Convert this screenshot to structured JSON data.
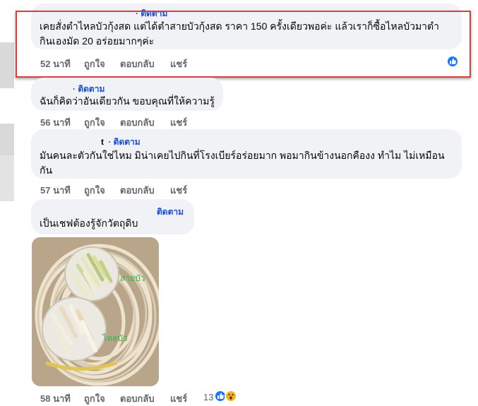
{
  "comments": [
    {
      "follow_label": "· ติดตาม",
      "text_line1": "เคยสั่งตำไหลบัวกุ้งสด แต่ได้ตำสายบัวกุ้งสด ราคา 150 ครั้งเดียวพอค่ะ แล้วเราก็ซื้อไหลบัวมาตำ",
      "text_line2": "กินเองมัด 20 อร่อยมากๆค่ะ",
      "time": "52 นาที",
      "like": "ถูกใจ",
      "reply": "ตอบกลับ",
      "share": "แชร์"
    },
    {
      "follow_label": "· ติดตาม",
      "text_line1": "ฉันก็คิดว่าอันเดียวกัน ขอบคุณที่ให้ความรู้",
      "time": "56 นาที",
      "like": "ถูกใจ",
      "reply": "ตอบกลับ",
      "share": "แชร์"
    },
    {
      "author_fragment": "t",
      "follow_label": "· ติดตาม",
      "text_line1": "มันคนละตัวกันใช่ไหม มิน่าเคยไปกินที่โรงเบียร์อร่อยมาก พอมากินข้างนอกคืองง ทำไม ไม่เหมือน",
      "text_line2": "กัน",
      "time": "57 นาที",
      "like": "ถูกใจ",
      "reply": "ตอบกลับ",
      "share": "แชร์"
    },
    {
      "follow_label": "ติดตาม",
      "text_line1": "เป็นเชฟต้องรู้จักวัตถุดิบ",
      "photo_label_top": "สายบัว",
      "photo_label_bottom": "ไหลบัว",
      "time": "58 นาที",
      "like": "ถูกใจ",
      "reply": "ตอบกลับ",
      "share": "แชร์",
      "reaction_count": "13"
    }
  ],
  "colors": {
    "follow": "#1b4fd0",
    "highlight": "#e03c3c",
    "like": "#1877f2",
    "bubble": "#f0f2f5"
  }
}
